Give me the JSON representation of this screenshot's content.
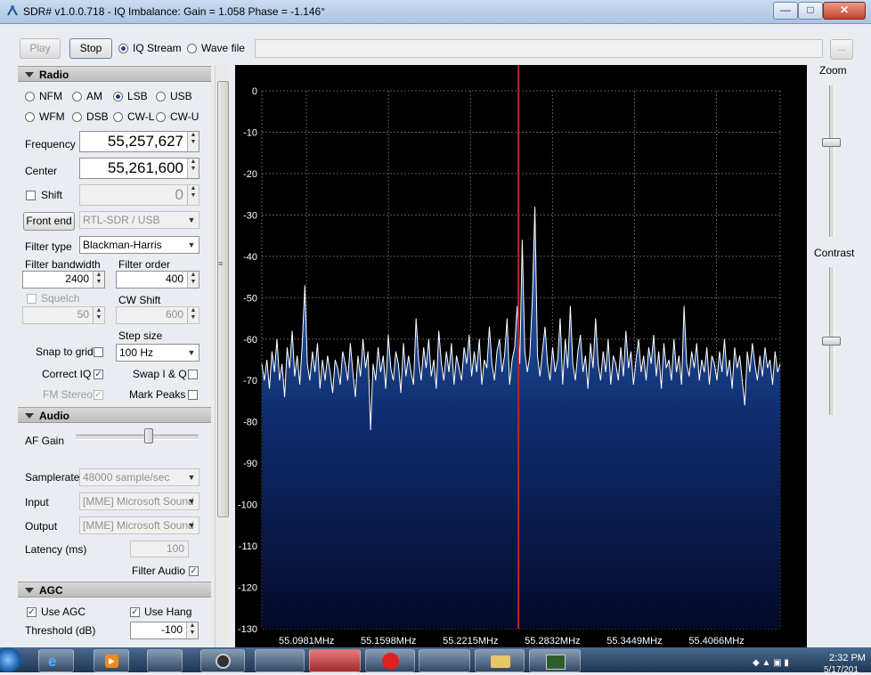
{
  "window": {
    "title": "SDR# v1.0.0.718 - IQ Imbalance: Gain = 1.058 Phase = -1.146°",
    "minimize": "—",
    "maximize": "□",
    "close": "✕"
  },
  "toolbar": {
    "play": "Play",
    "stop": "Stop",
    "iq_stream": "IQ Stream",
    "wave_file": "Wave file",
    "browse": "..."
  },
  "radio": {
    "section": "Radio",
    "modes": [
      "NFM",
      "AM",
      "LSB",
      "USB",
      "WFM",
      "DSB",
      "CW-L",
      "CW-U"
    ],
    "selected_mode": "LSB",
    "frequency_label": "Frequency",
    "frequency": "55,257,627",
    "center_label": "Center",
    "center": "55,261,600",
    "shift_label": "Shift",
    "shift": "0",
    "front_end_button": "Front end",
    "front_end": "RTL-SDR / USB",
    "filter_type_label": "Filter type",
    "filter_type": "Blackman-Harris",
    "filter_bandwidth_label": "Filter bandwidth",
    "filter_bandwidth": "2400",
    "filter_order_label": "Filter order",
    "filter_order": "400",
    "squelch_label": "Squelch",
    "squelch": "50",
    "cw_shift_label": "CW Shift",
    "cw_shift": "600",
    "step_size_label": "Step size",
    "step_size": "100 Hz",
    "snap_to_grid_label": "Snap to grid",
    "correct_iq_label": "Correct IQ",
    "swap_iq_label": "Swap I & Q",
    "fm_stereo_label": "FM Stereo",
    "mark_peaks_label": "Mark Peaks"
  },
  "audio": {
    "section": "Audio",
    "af_gain_label": "AF Gain",
    "af_gain_level": 0.6,
    "samplerate_label": "Samplerate",
    "samplerate": "48000 sample/sec",
    "input_label": "Input",
    "input": "[MME] Microsoft Sound",
    "output_label": "Output",
    "output": "[MME] Microsoft Sound",
    "latency_label": "Latency (ms)",
    "latency": "100",
    "filter_audio_label": "Filter Audio"
  },
  "agc": {
    "section": "AGC",
    "use_agc_label": "Use AGC",
    "use_hang_label": "Use Hang",
    "threshold_label": "Threshold (dB)",
    "threshold": "-100"
  },
  "side": {
    "zoom_label": "Zoom",
    "contrast_label": "Contrast",
    "zoom_level": 0.37,
    "contrast_level": 0.5
  },
  "taskbar": {
    "time": "2:32 PM",
    "date": "5/17/201"
  },
  "chart_data": {
    "type": "line",
    "title": "",
    "xlabel": "",
    "ylabel": "",
    "ylim": [
      -130,
      0
    ],
    "y_ticks": [
      "0",
      "-10",
      "-20",
      "-30",
      "-40",
      "-50",
      "-60",
      "-70",
      "-80",
      "-90",
      "-100",
      "-110",
      "-120",
      "-130"
    ],
    "x_ticks": [
      "55.0981MHz",
      "55.1598MHz",
      "55.2215MHz",
      "55.2832MHz",
      "55.3449MHz",
      "55.4066MHz"
    ],
    "x_tick_values": [
      55.0981,
      55.1598,
      55.2215,
      55.2832,
      55.3449,
      55.4066
    ],
    "xlim": [
      55.0645,
      55.4545
    ],
    "center_marker": 55.2576,
    "grid": true,
    "series": [
      {
        "values": [
          -66,
          -70,
          -65,
          -72,
          -63,
          -68,
          -60,
          -70,
          -66,
          -74,
          -62,
          -67,
          -58,
          -69,
          -64,
          -71,
          -61,
          -47,
          -66,
          -70,
          -63,
          -68,
          -61,
          -72,
          -65,
          -70,
          -64,
          -68,
          -73,
          -65,
          -67,
          -71,
          -63,
          -66,
          -70,
          -61,
          -68,
          -74,
          -64,
          -69,
          -60,
          -67,
          -63,
          -82,
          -66,
          -70,
          -62,
          -68,
          -64,
          -72,
          -59,
          -67,
          -70,
          -63,
          -66,
          -73,
          -61,
          -69,
          -64,
          -68,
          -71,
          -55,
          -65,
          -70,
          -62,
          -67,
          -60,
          -69,
          -65,
          -72,
          -58,
          -66,
          -70,
          -63,
          -68,
          -61,
          -71,
          -64,
          -67,
          -70,
          -62,
          -66,
          -59,
          -69,
          -63,
          -68,
          -60,
          -71,
          -65,
          -67,
          -57,
          -66,
          -70,
          -63,
          -60,
          -68,
          -64,
          -55,
          -71,
          -65,
          -62,
          -52,
          -66,
          -36,
          -63,
          -68,
          -64,
          -50,
          -28,
          -64,
          -69,
          -63,
          -57,
          -66,
          -70,
          -62,
          -68,
          -65,
          -55,
          -71,
          -60,
          -67,
          -52,
          -66,
          -70,
          -63,
          -59,
          -68,
          -64,
          -72,
          -61,
          -67,
          -55,
          -66,
          -70,
          -63,
          -68,
          -60,
          -71,
          -64,
          -66,
          -70,
          -62,
          -69,
          -58,
          -67,
          -63,
          -71,
          -65,
          -60,
          -68,
          -64,
          -70,
          -62,
          -66,
          -59,
          -69,
          -63,
          -72,
          -61,
          -67,
          -65,
          -70,
          -60,
          -68,
          -64,
          -71,
          -52,
          -66,
          -69,
          -63,
          -67,
          -61,
          -70,
          -65,
          -68,
          -62,
          -71,
          -64,
          -66,
          -70,
          -63,
          -68,
          -60,
          -69,
          -65,
          -72,
          -62,
          -67,
          -64,
          -70,
          -76,
          -63,
          -68,
          -61,
          -66,
          -70,
          -64,
          -69,
          -62,
          -67,
          -65,
          -71,
          -63,
          -68,
          -66
        ]
      }
    ]
  }
}
